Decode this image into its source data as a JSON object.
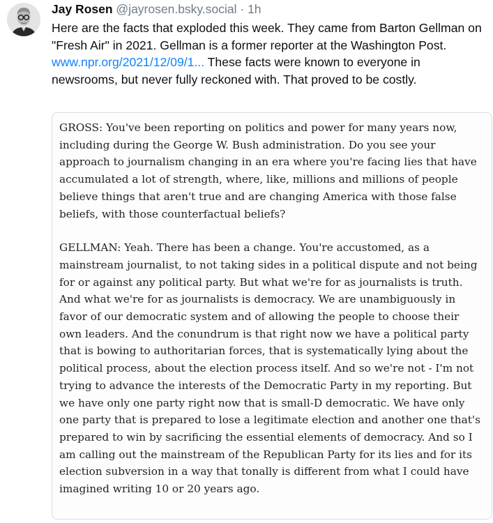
{
  "post": {
    "author": "Jay Rosen",
    "handle": "@jayrosen.bsky.social",
    "separator": "·",
    "time": "1h",
    "text_before_link": "Here are the facts that exploded this week. They came from Barton Gellman on \"Fresh Air\" in 2021. Gellman is a former reporter at the Washington Post. ",
    "link_text": "www.npr.org/2021/12/09/1...",
    "text_after_link": " These facts were known to everyone in newsrooms, but never fully reckoned with. That proved to be costly."
  },
  "transcript": {
    "paragraph1_lines": [
      "GROSS: You've been reporting on politics and power for many years now,",
      "including during the George W. Bush administration. Do you see your",
      "approach to journalism changing in an era where you're facing lies that have",
      "accumulated a lot of strength, where, like, millions and millions of people",
      "believe things that aren't true and are changing America with those false",
      "beliefs, with those counterfactual beliefs?"
    ],
    "paragraph2_lines": [
      "GELLMAN: Yeah. There has been a change. You're accustomed, as a",
      "mainstream journalist, to not taking sides in a political dispute and not being",
      "for or against any political party. But what we're for as journalists is truth.",
      "And what we're for as journalists is democracy. We are unambiguously in",
      "favor of our democratic system and of allowing the people to choose their",
      "own leaders. And the conundrum is that right now we have a political party",
      "that is bowing to authoritarian forces, that is systematically lying about the",
      "political process, about the election process itself. And so we're not - I'm not",
      "trying to advance the interests of the Democratic Party in my reporting. But",
      "we have only one party right now that is small-D democratic. We have only",
      "one party that is prepared to lose a legitimate election and another one that's",
      "prepared to win by sacrificing the essential elements of democracy. And so I",
      "am calling out the mainstream of the Republican Party for its lies and for its",
      "election subversion in a way that tonally is different from what I could have",
      "imagined writing 10 or 20 years ago."
    ]
  },
  "colors": {
    "link": "#1083fe",
    "muted": "#6f7b8a",
    "text": "#0b0f14"
  },
  "icons": {
    "avatar": "author-photo-avatar"
  }
}
